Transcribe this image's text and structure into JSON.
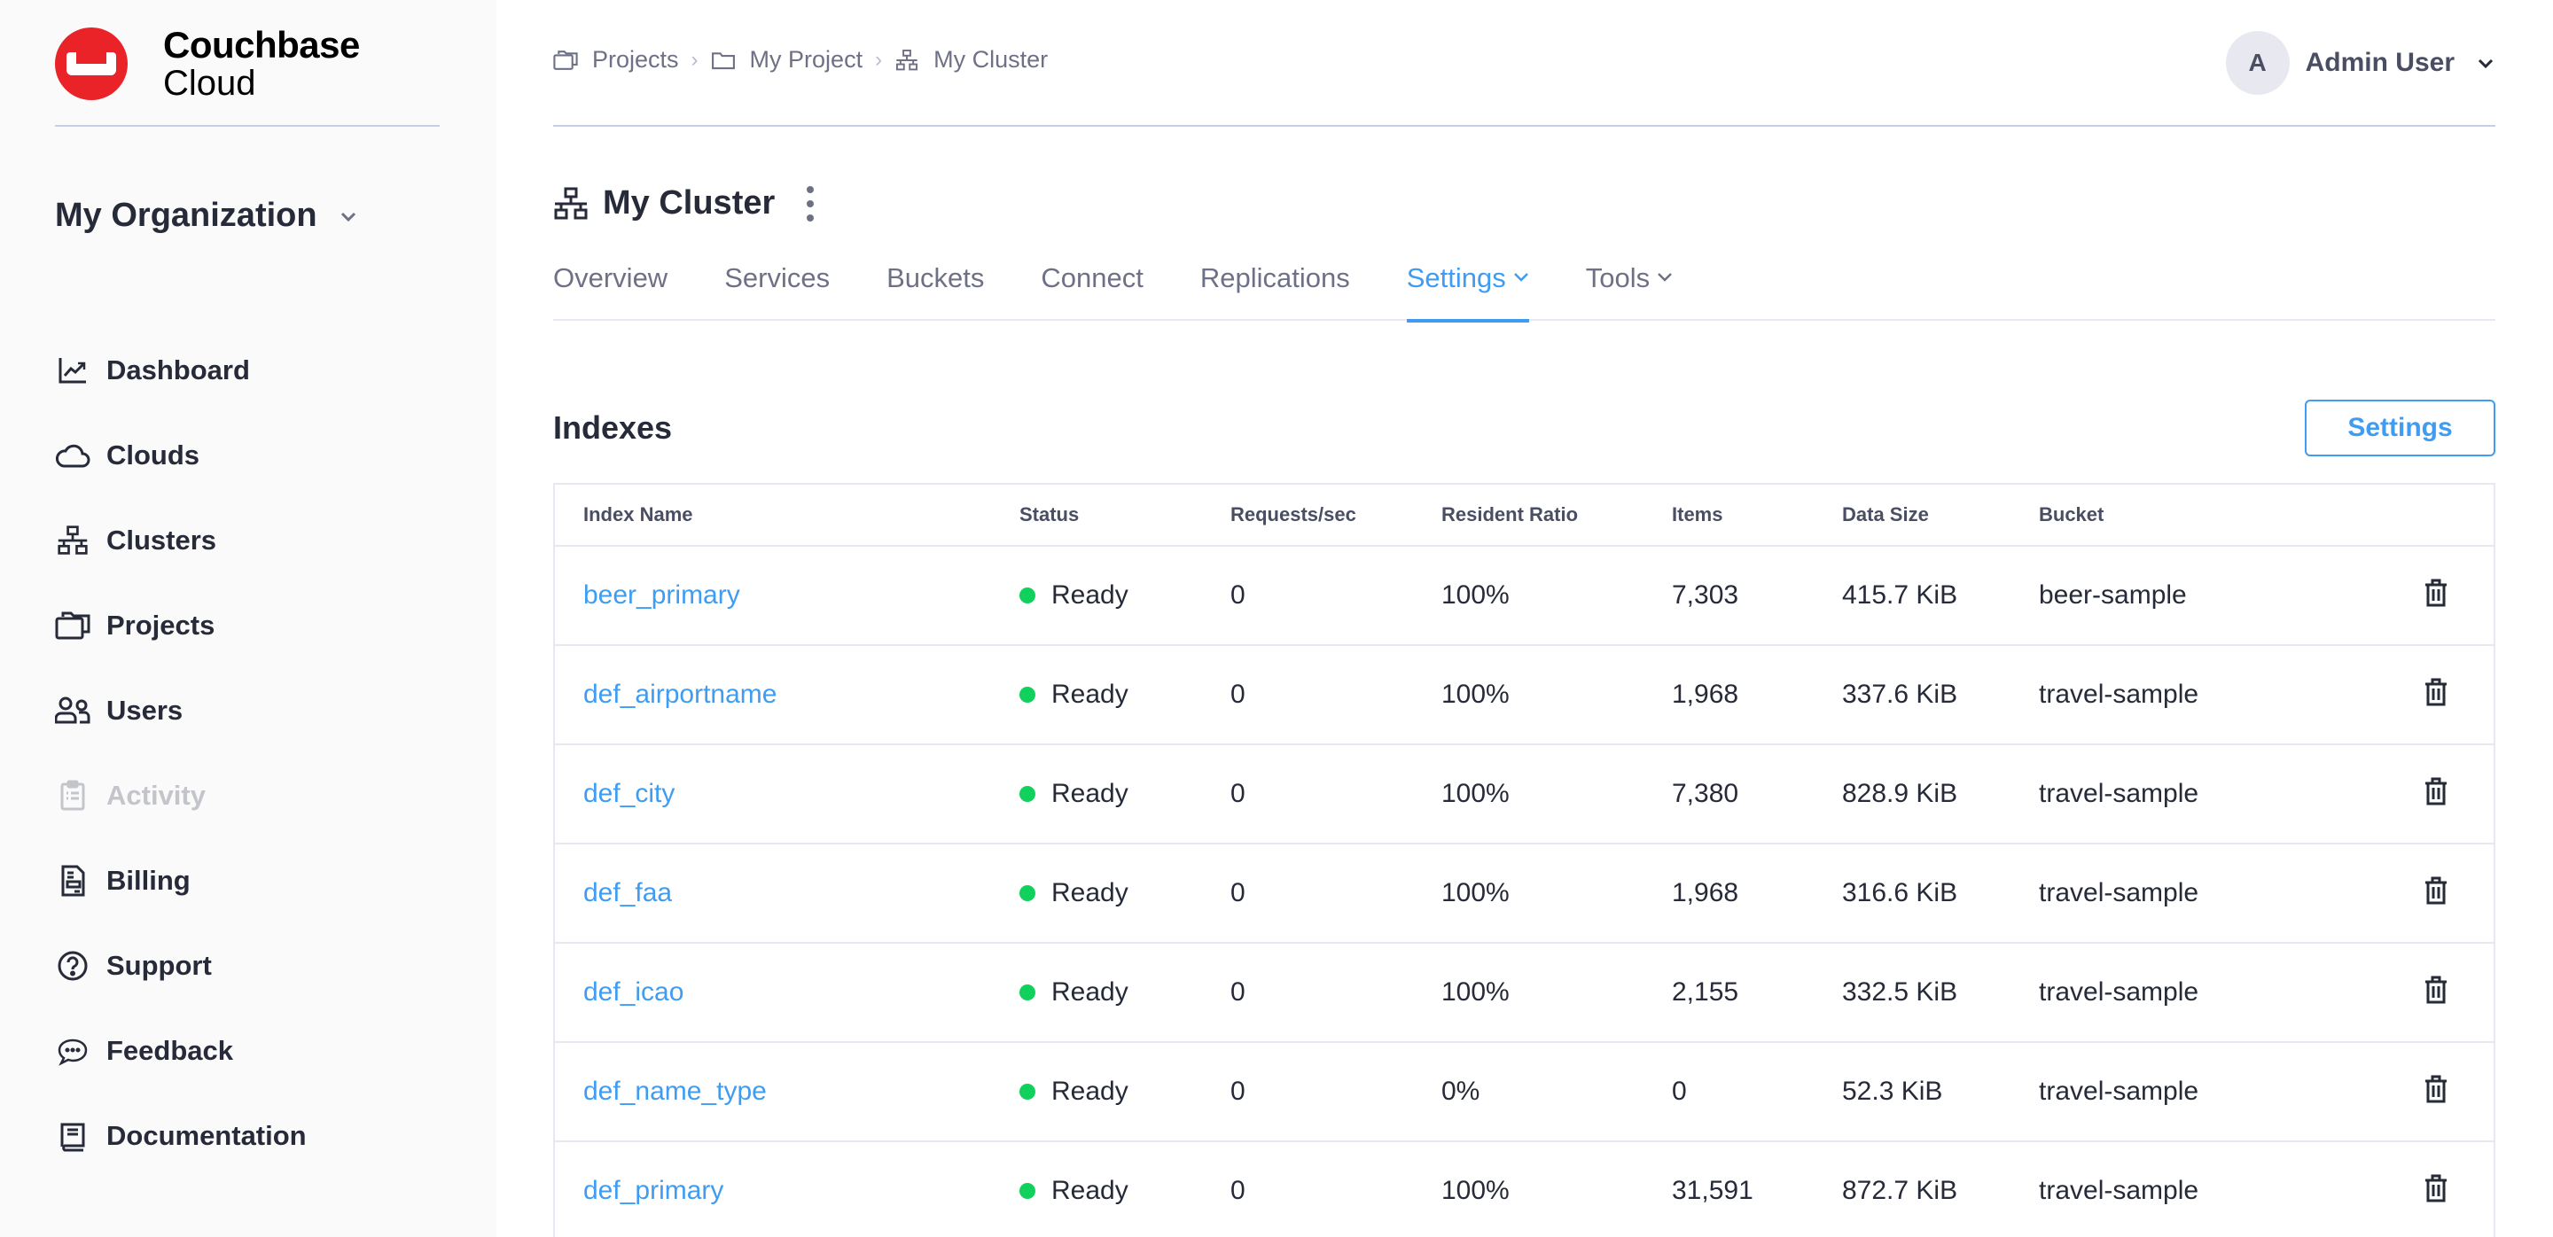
{
  "brand": {
    "line1": "Couchbase",
    "line2": "Cloud",
    "color": "#ea2328"
  },
  "org": {
    "label": "My Organization"
  },
  "sidebar": {
    "items": [
      {
        "label": "Dashboard",
        "icon": "chart-line-icon",
        "disabled": false
      },
      {
        "label": "Clouds",
        "icon": "cloud-icon",
        "disabled": false
      },
      {
        "label": "Clusters",
        "icon": "cluster-icon",
        "disabled": false
      },
      {
        "label": "Projects",
        "icon": "folders-icon",
        "disabled": false
      },
      {
        "label": "Users",
        "icon": "users-icon",
        "disabled": false
      },
      {
        "label": "Activity",
        "icon": "clipboard-list-icon",
        "disabled": true
      },
      {
        "label": "Billing",
        "icon": "invoice-icon",
        "disabled": false
      },
      {
        "label": "Support",
        "icon": "help-circle-icon",
        "disabled": false
      },
      {
        "label": "Feedback",
        "icon": "chat-bubble-icon",
        "disabled": false
      },
      {
        "label": "Documentation",
        "icon": "book-icon",
        "disabled": false
      }
    ]
  },
  "breadcrumb": {
    "items": [
      {
        "label": "Projects",
        "icon": "folders-icon"
      },
      {
        "label": "My Project",
        "icon": "folder-icon"
      },
      {
        "label": "My Cluster",
        "icon": "cluster-icon"
      }
    ],
    "separator": "›"
  },
  "user": {
    "initial": "A",
    "name": "Admin User"
  },
  "cluster": {
    "title": "My Cluster"
  },
  "tabs": [
    {
      "label": "Overview",
      "active": false,
      "dropdown": false
    },
    {
      "label": "Services",
      "active": false,
      "dropdown": false
    },
    {
      "label": "Buckets",
      "active": false,
      "dropdown": false
    },
    {
      "label": "Connect",
      "active": false,
      "dropdown": false
    },
    {
      "label": "Replications",
      "active": false,
      "dropdown": false
    },
    {
      "label": "Settings",
      "active": true,
      "dropdown": true
    },
    {
      "label": "Tools",
      "active": false,
      "dropdown": true
    }
  ],
  "indexes": {
    "title": "Indexes",
    "settings_button": "Settings",
    "columns": [
      "Index Name",
      "Status",
      "Requests/sec",
      "Resident Ratio",
      "Items",
      "Data Size",
      "Bucket"
    ],
    "rows": [
      {
        "name": "beer_primary",
        "status": "Ready",
        "requests": "0",
        "resident": "100%",
        "items": "7,303",
        "size": "415.7 KiB",
        "bucket": "beer-sample"
      },
      {
        "name": "def_airportname",
        "status": "Ready",
        "requests": "0",
        "resident": "100%",
        "items": "1,968",
        "size": "337.6 KiB",
        "bucket": "travel-sample"
      },
      {
        "name": "def_city",
        "status": "Ready",
        "requests": "0",
        "resident": "100%",
        "items": "7,380",
        "size": "828.9 KiB",
        "bucket": "travel-sample"
      },
      {
        "name": "def_faa",
        "status": "Ready",
        "requests": "0",
        "resident": "100%",
        "items": "1,968",
        "size": "316.6 KiB",
        "bucket": "travel-sample"
      },
      {
        "name": "def_icao",
        "status": "Ready",
        "requests": "0",
        "resident": "100%",
        "items": "2,155",
        "size": "332.5 KiB",
        "bucket": "travel-sample"
      },
      {
        "name": "def_name_type",
        "status": "Ready",
        "requests": "0",
        "resident": "0%",
        "items": "0",
        "size": "52.3 KiB",
        "bucket": "travel-sample"
      },
      {
        "name": "def_primary",
        "status": "Ready",
        "requests": "0",
        "resident": "100%",
        "items": "31,591",
        "size": "872.7 KiB",
        "bucket": "travel-sample"
      }
    ]
  },
  "colors": {
    "accent": "#3f9cf1",
    "status_ready": "#0fd15c",
    "text": "#262a39",
    "muted": "#6e7186"
  }
}
